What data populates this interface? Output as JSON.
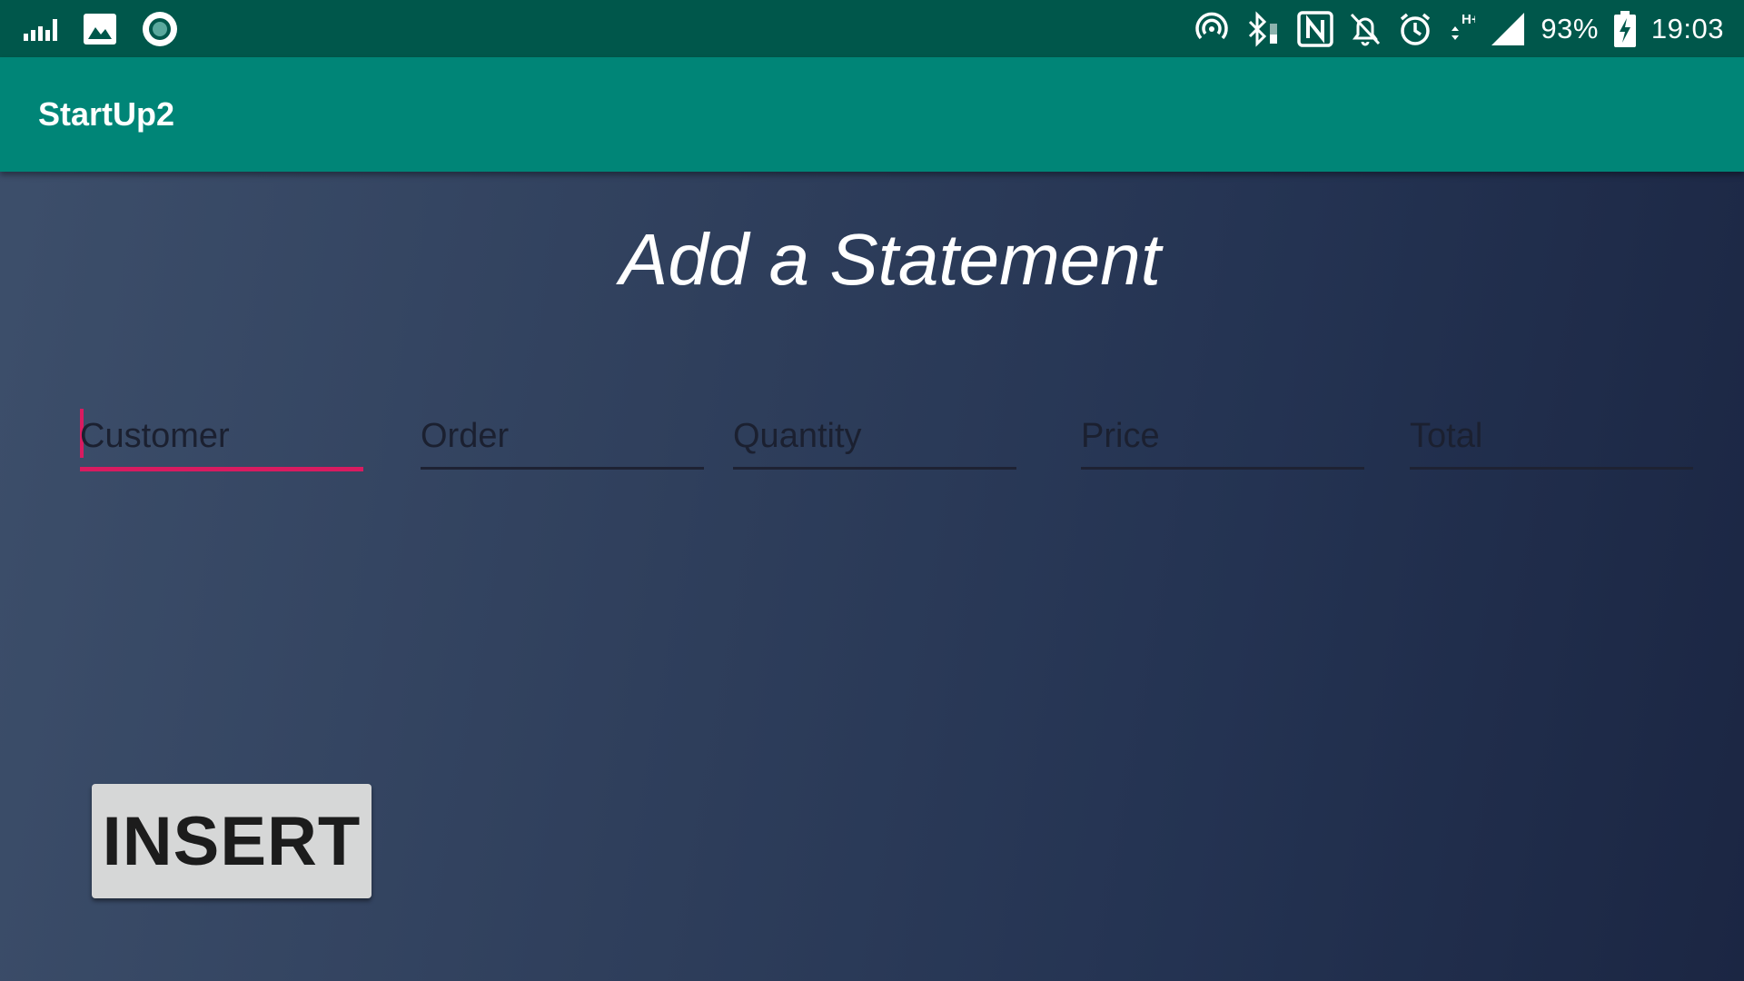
{
  "status_bar": {
    "left_icons": [
      "signal-bars-icon",
      "image-icon",
      "circle-record-icon"
    ],
    "right_icons": [
      "hotspot-icon",
      "bluetooth-icon",
      "nfc-icon",
      "bell-off-icon",
      "alarm-icon",
      "mobile-data-icon",
      "cell-signal-icon",
      "battery-charging-icon"
    ],
    "network_type": "H+",
    "battery_percent": "93%",
    "time": "19:03",
    "color": "#00574b"
  },
  "app_bar": {
    "title": "StartUp2",
    "color": "#008577"
  },
  "form": {
    "heading": "Add a Statement",
    "fields": {
      "customer": {
        "placeholder": "Customer",
        "value": ""
      },
      "order": {
        "placeholder": "Order",
        "value": ""
      },
      "quantity": {
        "placeholder": "Quantity",
        "value": ""
      },
      "price": {
        "placeholder": "Price",
        "value": ""
      },
      "total": {
        "placeholder": "Total",
        "value": ""
      }
    },
    "focused_field": "customer",
    "accent_color": "#d81b60",
    "insert_label": "INSERT"
  }
}
